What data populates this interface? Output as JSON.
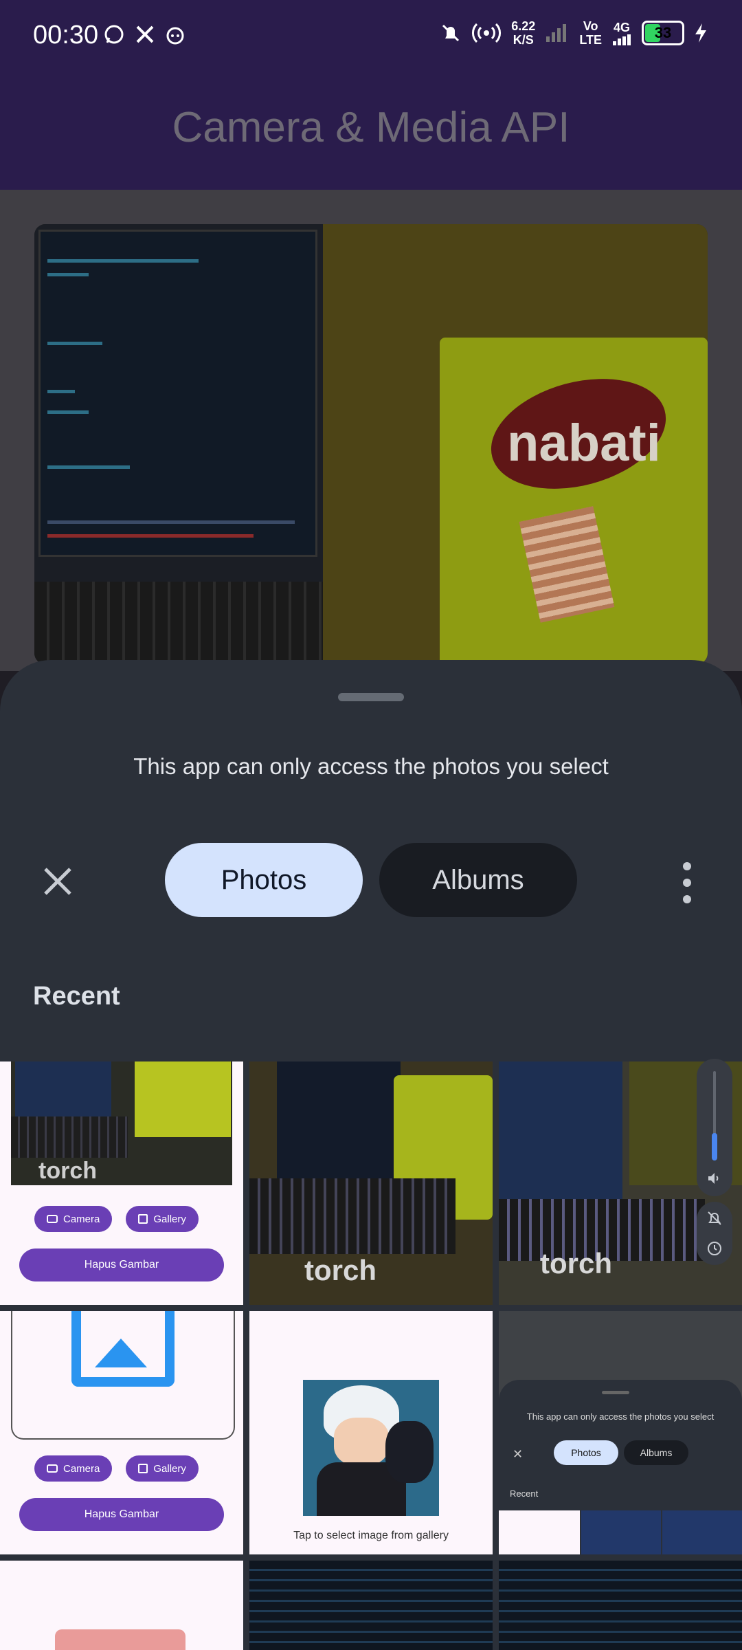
{
  "status_bar": {
    "time": "00:30",
    "net_speed_value": "6.22",
    "net_speed_unit": "K/S",
    "volte_top": "Vo",
    "volte_bottom": "LTE",
    "network": "4G",
    "battery": "33"
  },
  "app_bar": {
    "title": "Camera & Media API"
  },
  "photo_content": {
    "brand_text": "nabati"
  },
  "picker": {
    "message": "This app can only access the photos you select",
    "tabs": [
      "Photos",
      "Albums"
    ],
    "selected_tab": "Photos",
    "section_title": "Recent"
  },
  "thumbnails": {
    "camera_label": "Camera",
    "gallery_label": "Gallery",
    "remove_label": "Hapus Gambar",
    "tap_hint": "Tap to select image from gallery",
    "brand_logo": "torch",
    "mini_message": "This app can only access the photos you select",
    "mini_tab_photos": "Photos",
    "mini_tab_albums": "Albums",
    "mini_section": "Recent"
  },
  "colors": {
    "app_bar": "#2a1c4c",
    "sheet": "#2b3039",
    "tab_selected": "#d4e3fd",
    "tab_unselected": "#191c22",
    "button_purple": "#6a3fb5",
    "volume_level": "#4a86f0"
  }
}
